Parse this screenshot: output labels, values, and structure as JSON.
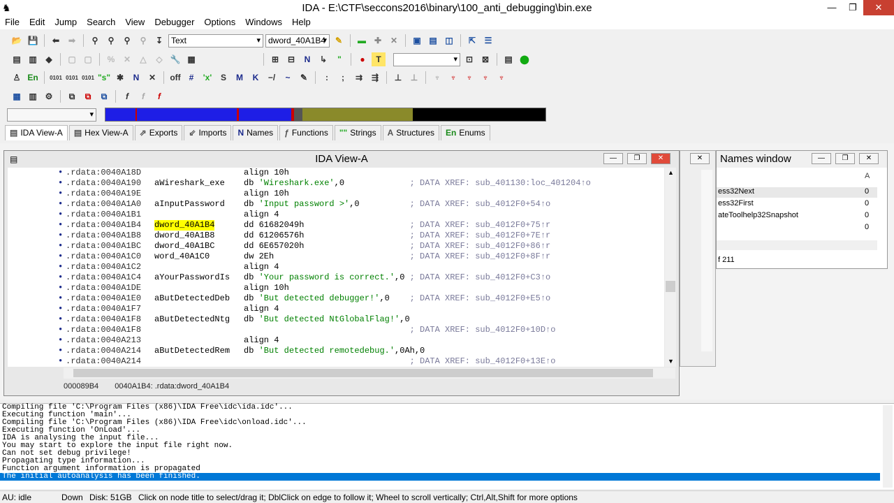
{
  "window": {
    "title": "IDA - E:\\CTF\\seccons2016\\binary\\100_anti_debugging\\bin.exe",
    "min": "—",
    "max": "❐",
    "close": "✕"
  },
  "menu": [
    "File",
    "Edit",
    "Jump",
    "Search",
    "View",
    "Debugger",
    "Options",
    "Windows",
    "Help"
  ],
  "toolbar": {
    "display_mode": "Text",
    "name_combo": "dword_40A1B4"
  },
  "tabs": [
    {
      "icon": "▤",
      "label": "IDA View-A"
    },
    {
      "icon": "▤",
      "label": "Hex View-A"
    },
    {
      "icon": "⇗",
      "label": "Exports"
    },
    {
      "icon": "⇙",
      "label": "Imports"
    },
    {
      "icon": "N",
      "label": "Names"
    },
    {
      "icon": "ƒ",
      "label": "Functions"
    },
    {
      "icon": "\"\"",
      "label": "Strings"
    },
    {
      "icon": "A",
      "label": "Structures"
    },
    {
      "icon": "En",
      "label": "Enums"
    }
  ],
  "idaview": {
    "title": "IDA View-A",
    "lines": [
      {
        "addr": ".rdata:0040A18D",
        "label": "",
        "ins": "align 10h",
        "cmt": ""
      },
      {
        "addr": ".rdata:0040A190",
        "label": "aWireshark_exe",
        "ins": "db 'Wireshark.exe',0",
        "cmt": "; DATA XREF: sub_401130:loc_401204↑o"
      },
      {
        "addr": ".rdata:0040A19E",
        "label": "",
        "ins": "align 10h",
        "cmt": ""
      },
      {
        "addr": ".rdata:0040A1A0",
        "label": "aInputPassword",
        "ins": "db 'Input password >',0",
        "cmt": "; DATA XREF: sub_4012F0+54↑o"
      },
      {
        "addr": ".rdata:0040A1B1",
        "label": "",
        "ins": "align 4",
        "cmt": ""
      },
      {
        "addr": ".rdata:0040A1B4",
        "label": "dword_40A1B4",
        "ins": "dd 61682049h",
        "cmt": "; DATA XREF: sub_4012F0+75↑r"
      },
      {
        "addr": ".rdata:0040A1B8",
        "label": "dword_40A1B8",
        "ins": "dd 61206576h",
        "cmt": "; DATA XREF: sub_4012F0+7E↑r"
      },
      {
        "addr": ".rdata:0040A1BC",
        "label": "dword_40A1BC",
        "ins": "dd 6E657020h",
        "cmt": "; DATA XREF: sub_4012F0+86↑r"
      },
      {
        "addr": ".rdata:0040A1C0",
        "label": "word_40A1C0",
        "ins": "dw 2Eh",
        "cmt": "; DATA XREF: sub_4012F0+8F↑r"
      },
      {
        "addr": ".rdata:0040A1C2",
        "label": "",
        "ins": "align 4",
        "cmt": ""
      },
      {
        "addr": ".rdata:0040A1C4",
        "label": "aYourPasswordIs",
        "ins": "db 'Your password is correct.',0",
        "cmt": "; DATA XREF: sub_4012F0+C3↑o"
      },
      {
        "addr": ".rdata:0040A1DE",
        "label": "",
        "ins": "align 10h",
        "cmt": ""
      },
      {
        "addr": ".rdata:0040A1E0",
        "label": "aButDetectedDeb",
        "ins": "db 'But detected debugger!',0",
        "cmt": "; DATA XREF: sub_4012F0+E5↑o"
      },
      {
        "addr": ".rdata:0040A1F7",
        "label": "",
        "ins": "align 4",
        "cmt": ""
      },
      {
        "addr": ".rdata:0040A1F8",
        "label": "aButDetectedNtg",
        "ins": "db 'But detected NtGlobalFlag!',0",
        "cmt": ""
      },
      {
        "addr": ".rdata:0040A1F8",
        "label": "",
        "ins": "",
        "cmt": "; DATA XREF: sub_4012F0+10D↑o"
      },
      {
        "addr": ".rdata:0040A213",
        "label": "",
        "ins": "align 4",
        "cmt": ""
      },
      {
        "addr": ".rdata:0040A214",
        "label": "aButDetectedRem",
        "ins": "db 'But detected remotedebug.',0Ah,0",
        "cmt": ""
      },
      {
        "addr": ".rdata:0040A214",
        "label": "",
        "ins": "",
        "cmt": "; DATA XREF: sub_4012F0+13E↑o"
      }
    ],
    "status_offset": "000089B4",
    "status_addr": "0040A1B4: .rdata:dword_40A1B4"
  },
  "names_window": {
    "title": "Names window",
    "col_a": "A",
    "items": [
      {
        "name": "ess32Next",
        "val": "0"
      },
      {
        "name": "ess32First",
        "val": "0"
      },
      {
        "name": "ateToolhelp32Snapshot",
        "val": "0"
      },
      {
        "name": "",
        "val": "0"
      }
    ],
    "footer": "f 211"
  },
  "output": [
    "Compiling file 'C:\\Program Files (x86)\\IDA Free\\idc\\ida.idc'...",
    "Executing function 'main'...",
    "Compiling file 'C:\\Program Files (x86)\\IDA Free\\idc\\onload.idc'...",
    "Executing function 'OnLoad'...",
    "IDA is analysing the input file...",
    "You may start to explore the input file right now.",
    "Can not set debug privilege!",
    "Propagating type information...",
    "Function argument information is propagated",
    "The initial autoanalysis has been finished."
  ],
  "status": {
    "au": "AU:  idle",
    "dir": "Down",
    "disk": "Disk: 51GB",
    "hint": "Click on node title to select/drag it; DblClick on edge to follow it; Wheel to scroll vertically; Ctrl,Alt,Shift for more options"
  }
}
